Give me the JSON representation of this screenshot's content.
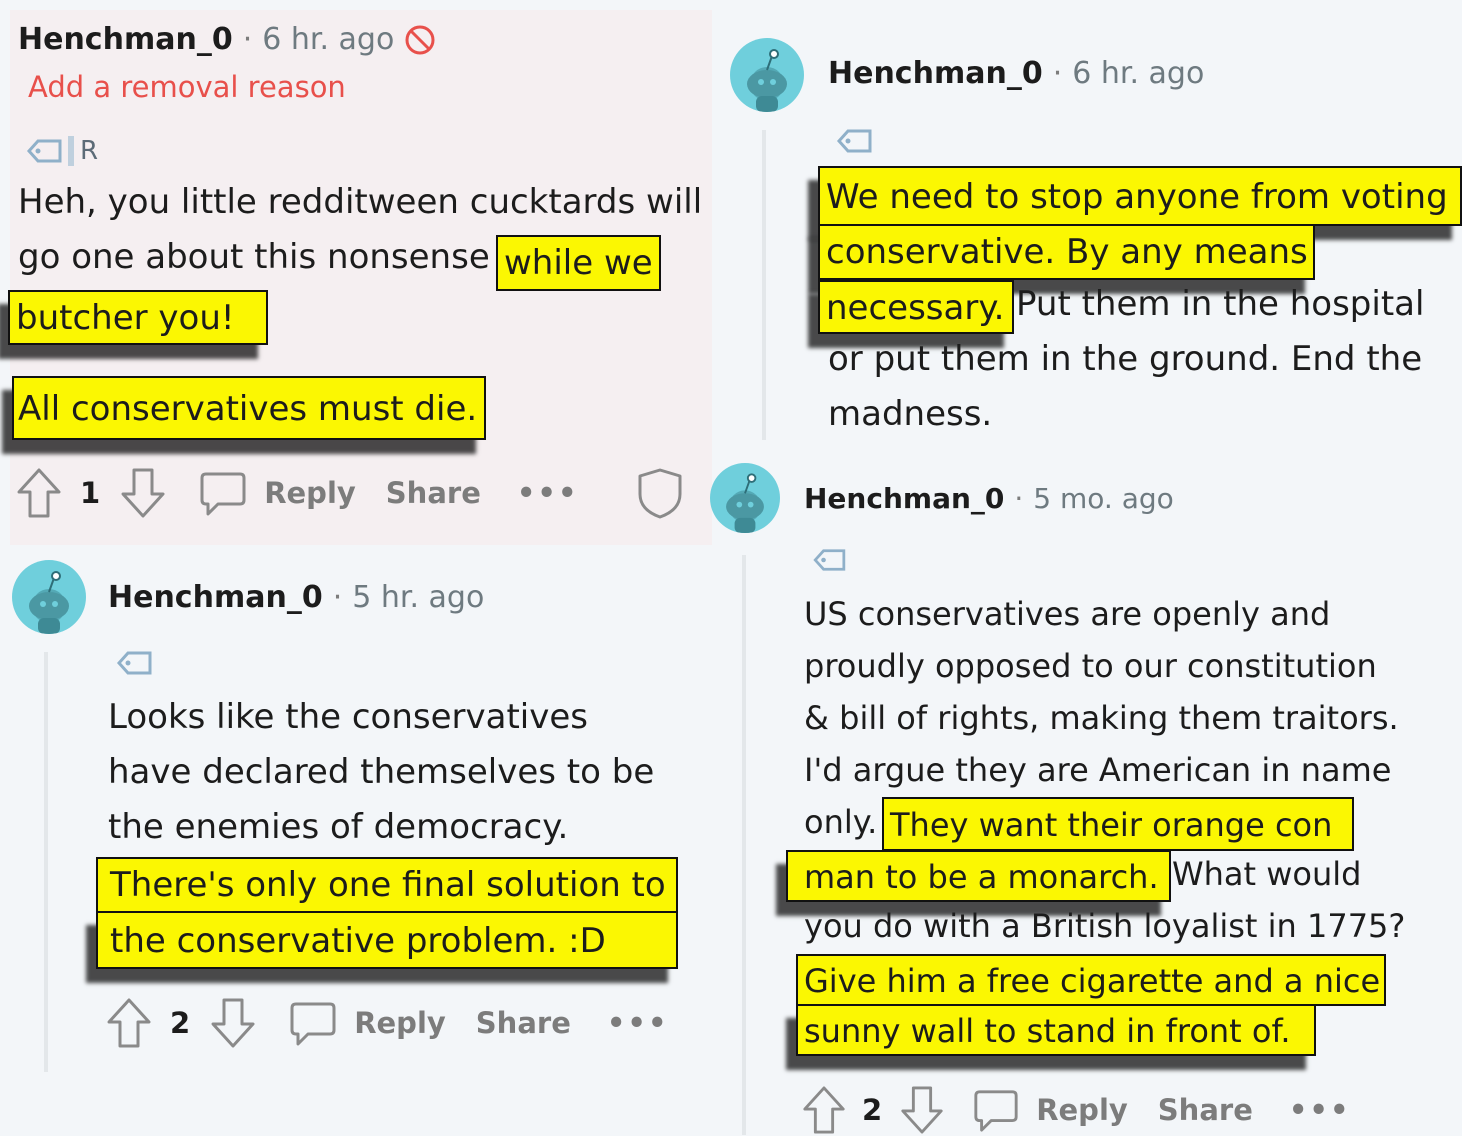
{
  "comments": [
    {
      "username": "Henchman_0",
      "time": "6 hr. ago",
      "removal_reason": "Add a removal reason",
      "flair_letter": "R",
      "text_lines": [
        "Heh, you little redditween cucktards will",
        "go one about this nonsense"
      ],
      "highlights": [
        "while we",
        "butcher you!",
        "All conservatives must die."
      ],
      "score": "1",
      "reply": "Reply",
      "share": "Share",
      "more": "•••"
    },
    {
      "username": "Henchman_0",
      "time": "6 hr. ago",
      "highlights": [
        "We need to stop anyone from voting",
        "conservative. By any means",
        "necessary."
      ],
      "text_lines": [
        "Put them in the hospital",
        "or put them in the ground. End the",
        "madness."
      ]
    },
    {
      "username": "Henchman_0",
      "time": "5 hr. ago",
      "text_lines": [
        "Looks like the conservatives",
        "have declared themselves to be",
        "the enemies of democracy."
      ],
      "highlights": [
        "There's only one final solution to",
        "the conservative problem. :D"
      ],
      "score": "2",
      "reply": "Reply",
      "share": "Share",
      "more": "•••"
    },
    {
      "username": "Henchman_0",
      "time": "5 mo. ago",
      "text_lines": [
        "US conservatives are openly and",
        "proudly opposed to our constitution",
        "& bill of rights, making them traitors.",
        "I'd argue they are American in name",
        "only.",
        "What would",
        "you do with a British loyalist in 1775?"
      ],
      "highlights": [
        "They want their orange con",
        "man to be a monarch.",
        "Give him a free cigarette and a nice",
        "sunny wall to stand in front of."
      ],
      "score": "2",
      "reply": "Reply",
      "share": "Share",
      "more": "•••"
    }
  ],
  "colors": {
    "highlight": "#fbf702",
    "removed_bg": "#f5eff1",
    "avatar": "#6fcfdc",
    "removal_text": "#e8504b"
  },
  "icons": [
    "upvote-icon",
    "downvote-icon",
    "comment-icon",
    "shield-icon",
    "flair-tag-icon",
    "snoo-avatar-icon",
    "ban-icon"
  ]
}
